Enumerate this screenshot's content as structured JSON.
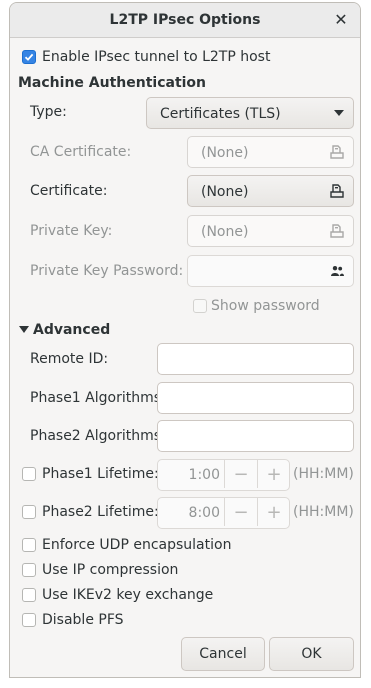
{
  "dialog": {
    "title": "L2TP IPsec Options",
    "close_glyph": "✕"
  },
  "enable_ipsec": {
    "label": "Enable IPsec tunnel to L2TP host",
    "checked": true
  },
  "machine_auth": {
    "heading": "Machine Authentication",
    "type_label": "Type:",
    "type_value": "Certificates (TLS)",
    "ca_label": "CA Certificate:",
    "ca_value": "(None)",
    "cert_label": "Certificate:",
    "cert_value": "(None)",
    "key_label": "Private Key:",
    "key_value": "(None)",
    "key_password_label": "Private Key Password:",
    "key_password_value": "",
    "show_password_label": "Show password"
  },
  "advanced": {
    "heading": "Advanced",
    "remote_id_label": "Remote ID:",
    "remote_id_value": "",
    "phase1_alg_label": "Phase1 Algorithms:",
    "phase1_alg_value": "",
    "phase2_alg_label": "Phase2 Algorithms:",
    "phase2_alg_value": "",
    "phase1_lifetime_label": "Phase1 Lifetime:",
    "phase1_lifetime_value": "1:00",
    "phase2_lifetime_label": "Phase2 Lifetime:",
    "phase2_lifetime_value": "8:00",
    "lifetime_unit": "(HH:MM)",
    "minus_glyph": "−",
    "plus_glyph": "+",
    "enforce_udp_label": "Enforce UDP encapsulation",
    "ip_compression_label": "Use IP compression",
    "ikev2_label": "Use IKEv2 key exchange",
    "disable_pfs_label": "Disable PFS"
  },
  "buttons": {
    "cancel": "Cancel",
    "ok": "OK"
  },
  "colors": {
    "accent": "#3584e4",
    "dim_text": "#929595"
  }
}
